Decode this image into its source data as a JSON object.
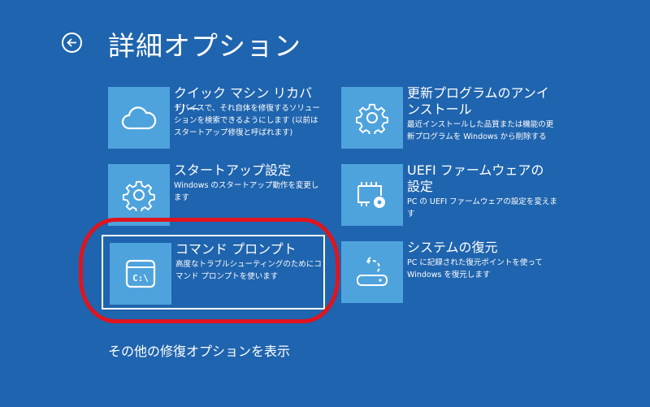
{
  "header": {
    "title": "詳細オプション",
    "back_icon": "back-arrow-icon"
  },
  "options": [
    {
      "name": "クイック マシン リカバリー",
      "desc": "デバイスで、それ自体を修復するソリューションを検索できるようにします (以前はスタートアップ修復と呼ばれます)",
      "icon": "cloud-icon"
    },
    {
      "name": "更新プログラムのアンインストール",
      "desc": "最近インストールした品質または機能の更新プログラムを Windows から削除する",
      "icon": "gear-icon"
    },
    {
      "name": "スタートアップ設定",
      "desc": "Windows のスタートアップ動作を変更します",
      "icon": "gear-icon"
    },
    {
      "name": "UEFI ファームウェアの設定",
      "desc": "PC の UEFI ファームウェアの設定を変えます",
      "icon": "chip-gear-icon"
    },
    {
      "name": "コマンド プロンプト",
      "desc": "高度なトラブルシューティングのためにコマンド プロンプトを使います",
      "icon": "command-prompt-icon",
      "selected": true
    },
    {
      "name": "システムの復元",
      "desc": "PC に記録された復元ポイントを使って Windows を復元します",
      "icon": "restore-icon"
    }
  ],
  "more_link": "その他の修復オプションを表示",
  "colors": {
    "background": "#1f64ae",
    "tile": "#4ea3dd",
    "highlight": "#e0141e"
  }
}
